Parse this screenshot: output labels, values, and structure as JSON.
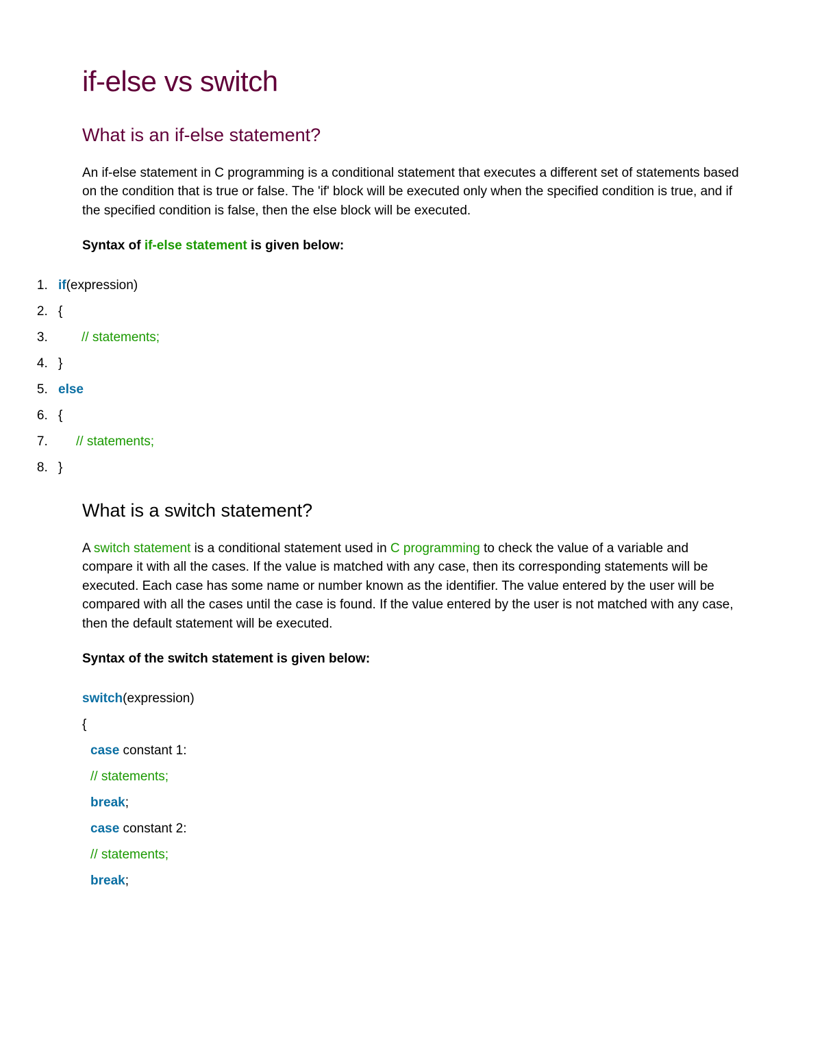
{
  "title": "if-else vs switch",
  "section1": {
    "heading": "What is an if-else statement?",
    "paragraph": "An if-else statement in C programming is a conditional statement that executes a different set of statements based on the condition that is true or false. The 'if' block will be executed only when the specified condition is true, and if the specified condition is false, then the else block will be executed.",
    "syntax_label_before": "Syntax of ",
    "syntax_label_link": "if-else statement",
    "syntax_label_after": " is given below:",
    "code": {
      "line1_kw": "if",
      "line1_rest": "(expression)",
      "line2": "{",
      "line3_indent": "    ",
      "line3_comment": "// statements;",
      "line4": "}",
      "line5_kw": "else",
      "line6": "{",
      "line7_indent": "   ",
      "line7_comment": "// statements;",
      "line8": "}"
    }
  },
  "section2": {
    "heading": "What is a switch statement?",
    "para_before_link1": "A ",
    "para_link1": "switch statement",
    "para_mid": " is a conditional statement used in ",
    "para_link2": "C programming",
    "para_after": " to check the value of a variable and compare it with all the cases. If the value is matched with any case, then its corresponding statements will be executed. Each case has some name or number known as the identifier. The value entered by the user will be compared with all the cases until the case is found. If the value entered by the user is not matched with any case, then the default statement will be executed.",
    "syntax_label": "Syntax of the switch statement is given below:",
    "code": {
      "l1_kw": "switch",
      "l1_rest": "(expression)",
      "l2": "{",
      "l3_kw": "case",
      "l3_rest": " constant 1:",
      "l4_comment": "// statements;",
      "l5_kw": "break",
      "l5_rest": ";",
      "l6_kw": "case",
      "l6_rest": " constant 2:",
      "l7_comment": "// statements;",
      "l8_kw": "break",
      "l8_rest": ";"
    }
  }
}
